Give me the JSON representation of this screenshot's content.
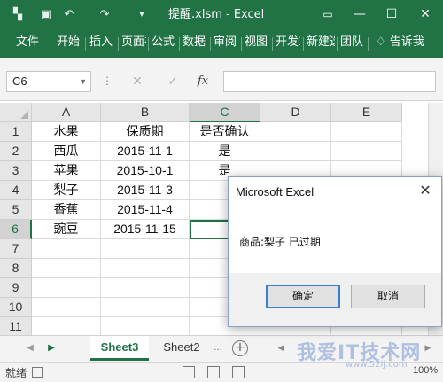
{
  "titlebar": {
    "title": "提醒.xlsm - Excel",
    "qa_icons": [
      "excel-logo-icon",
      "save-icon",
      "undo-icon",
      "redo-icon",
      "customize-icon"
    ],
    "controls": [
      "ribbon-display-icon",
      "minimize-icon",
      "maximize-icon",
      "close-icon"
    ]
  },
  "ribbon": {
    "tabs": [
      "文件",
      "开始",
      "插入",
      "页面布局",
      "公式",
      "数据",
      "审阅",
      "视图",
      "开发工具",
      "新建选项卡",
      "团队"
    ],
    "tellme": "告诉我"
  },
  "formula_bar": {
    "name_box": "C6",
    "fx": "fx",
    "formula": ""
  },
  "grid": {
    "columns": [
      "A",
      "B",
      "C",
      "D",
      "E"
    ],
    "rows": [
      "1",
      "2",
      "3",
      "4",
      "5",
      "6",
      "7",
      "8",
      "9",
      "10",
      "11"
    ],
    "cells": [
      [
        "水果",
        "保质期",
        "是否确认",
        "",
        ""
      ],
      [
        "西瓜",
        "2015-11-1",
        "是",
        "",
        ""
      ],
      [
        "苹果",
        "2015-10-1",
        "是",
        "",
        ""
      ],
      [
        "梨子",
        "2015-11-3",
        "",
        "",
        ""
      ],
      [
        "香蕉",
        "2015-11-4",
        "",
        "",
        ""
      ],
      [
        "豌豆",
        "2015-11-15",
        "",
        "",
        ""
      ],
      [
        "",
        "",
        "",
        "",
        ""
      ],
      [
        "",
        "",
        "",
        "",
        ""
      ],
      [
        "",
        "",
        "",
        "",
        ""
      ],
      [
        "",
        "",
        "",
        "",
        ""
      ],
      [
        "",
        "",
        "",
        "",
        ""
      ]
    ],
    "active_cell": "C6"
  },
  "sheets": {
    "tabs": [
      "Sheet3",
      "Sheet2"
    ],
    "active": "Sheet3",
    "ellipsis": "..."
  },
  "status": {
    "ready": "就绪",
    "zoom": "100%"
  },
  "dialog": {
    "title": "Microsoft Excel",
    "message": "商品:梨子 已过期",
    "ok": "确定",
    "cancel": "取消"
  },
  "watermark": {
    "text": "我爱IT技术网",
    "sub": "www.52ij.com"
  }
}
